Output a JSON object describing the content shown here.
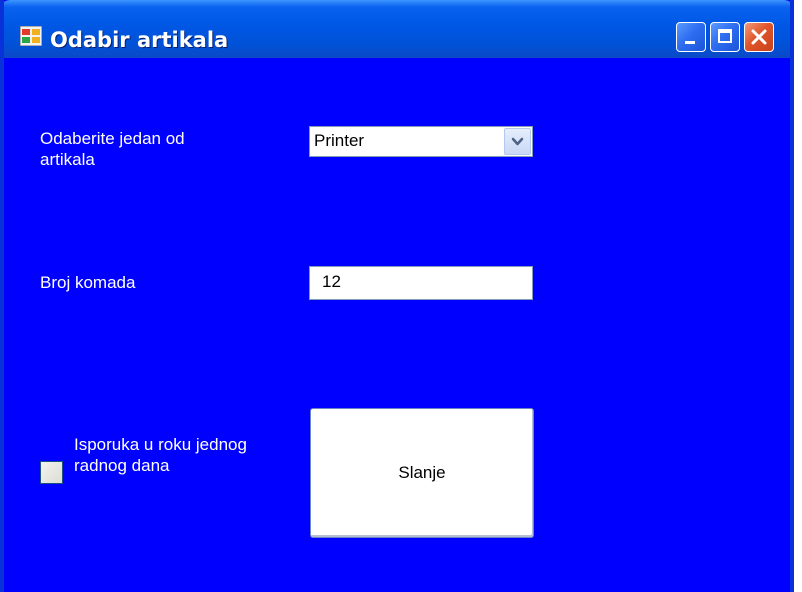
{
  "window": {
    "title": "Odabir artikala",
    "icon": "app-window-icon"
  },
  "titlebar_buttons": {
    "minimize": "minimize-icon",
    "maximize": "maximize-icon",
    "close": "close-icon"
  },
  "form": {
    "article_label": "Odaberite jedan od artikala",
    "article_selected": "Printer",
    "quantity_label": "Broj komada",
    "quantity_value": "12",
    "delivery_checkbox_label": "Isporuka u roku jednog radnog dana",
    "delivery_checked": false,
    "send_button_label": "Slanje"
  },
  "colors": {
    "form_background": "#0000ff",
    "titlebar": "#0058e6",
    "close_button": "#e0562a"
  }
}
